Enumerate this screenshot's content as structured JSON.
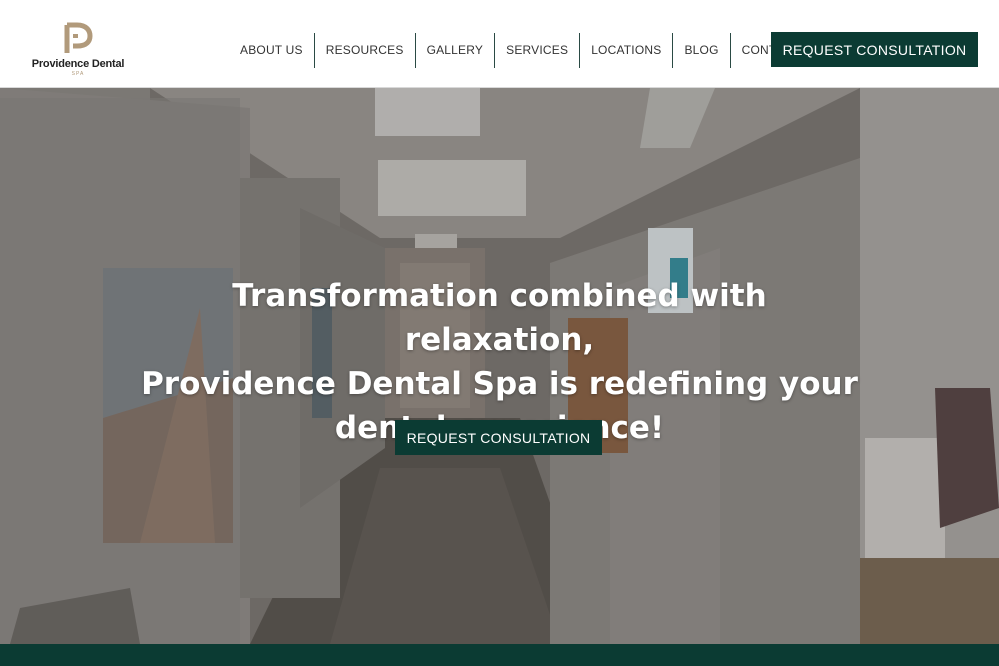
{
  "brand": {
    "name": "Providence Dental",
    "tagline": "SPA",
    "logo_icon": "pd-monogram-icon",
    "accent_color": "#b19a7b",
    "primary_color": "#0b3b33"
  },
  "nav": {
    "items": [
      {
        "label": "ABOUT US"
      },
      {
        "label": "RESOURCES"
      },
      {
        "label": "GALLERY"
      },
      {
        "label": "SERVICES"
      },
      {
        "label": "LOCATIONS"
      },
      {
        "label": "BLOG"
      },
      {
        "label": "CONTACT US"
      }
    ],
    "cta_label": "REQUEST CONSULTATION"
  },
  "hero": {
    "title_line1": "Transformation combined with relaxation,",
    "title_line2": "Providence Dental Spa is redefining your",
    "title_line3": "dental experience!",
    "cta_label": "REQUEST CONSULTATION",
    "background": "dental-office-hallway-photo"
  }
}
